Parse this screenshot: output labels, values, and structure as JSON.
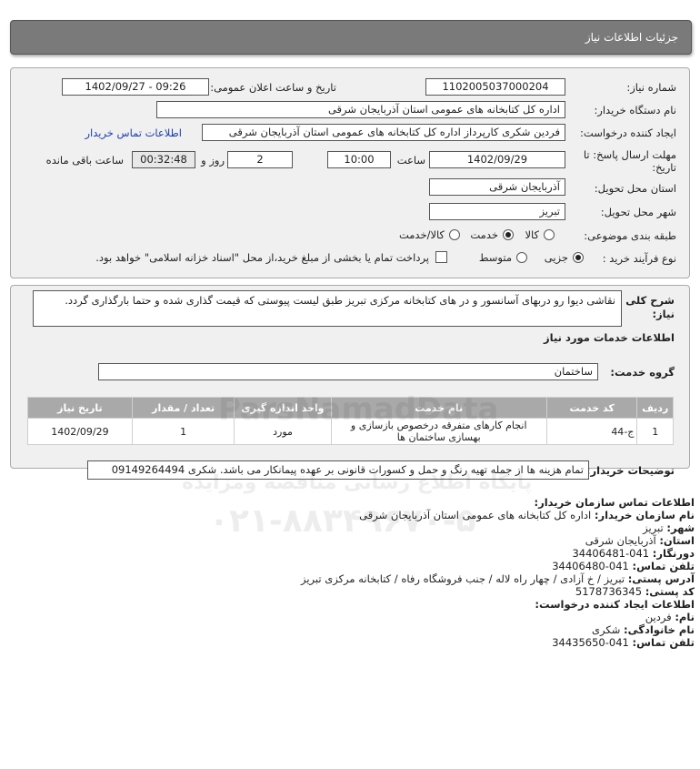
{
  "header": {
    "title": "جزئیات اطلاعات نیاز"
  },
  "need": {
    "need_number_label": "شماره نیاز:",
    "need_number": "1102005037000204",
    "announce_label": "تاریخ و ساعت اعلان عمومی:",
    "announce_value": "1402/09/27 - 09:26",
    "buyer_label": "نام دستگاه خریدار:",
    "buyer_value": "اداره کل کتابخانه های عمومی استان آذربایجان شرقی",
    "creator_label": "ایجاد کننده درخواست:",
    "creator_value": "فردین شکری کارپرداز اداره کل کتابخانه های عمومی استان آذربایجان شرقی",
    "contact_link": "اطلاعات تماس خریدار",
    "deadline_label_1": "مهلت ارسال پاسخ: تا",
    "deadline_label_2": "تاریخ:",
    "deadline_date": "1402/09/29",
    "time_label": "ساعت",
    "deadline_time": "10:00",
    "days_value": "2",
    "days_label": "روز و",
    "remaining_time": "00:32:48",
    "remaining_label": "ساعت باقی مانده",
    "province_label": "استان محل تحویل:",
    "province_value": "آذربایجان شرقی",
    "city_label": "شهر محل تحویل:",
    "city_value": "تبریز",
    "category_label": "طبقه بندی موضوعی:",
    "category_options": [
      "کالا",
      "خدمت",
      "کالا/خدمت"
    ],
    "category_selected": 1,
    "process_label": "نوع فرآیند خرید :",
    "process_options": [
      "جزیی",
      "متوسط"
    ],
    "process_selected": 0,
    "payment_note": "پرداخت تمام یا بخشی از مبلغ خرید،از محل \"اسناد خزانه اسلامی\" خواهد بود."
  },
  "summary": {
    "label_1": "شرح کلی",
    "label_2": "نیاز:",
    "text": "نقاشی دیوا رو دربهای آسانسور و در های کتابخانه مرکزی تبریز طبق لیست پیوستی که قیمت گذاری شده و حتما بارگذاری گردد."
  },
  "services": {
    "title": "اطلاعات خدمات مورد نیاز",
    "group_label": "گروه خدمت:",
    "group_value": "ساختمان",
    "columns": [
      "ردیف",
      "کد خدمت",
      "نام خدمت",
      "واحد اندازه گیری",
      "تعداد / مقدار",
      "تاریخ نیاز"
    ],
    "rows": [
      {
        "index": "1",
        "code": "ج-44",
        "name": "انجام کارهای متفرقه درخصوص بازسازی و بهسازی ساختمان ها",
        "unit": "مورد",
        "qty": "1",
        "date": "1402/09/29"
      }
    ]
  },
  "buyer_notes": {
    "label": "توضیحات خریدار:",
    "text": "تمام هزینه ها از جمله تهیه رنگ و حمل و کسورات قانونی بر عهده پیمانکار می باشد. شکری 09149264494"
  },
  "contact": {
    "title": "اطلاعات تماس سازمان خریدار:",
    "org_label": "نام سازمان خریدار:",
    "org_value": "اداره کل کتابخانه های عمومی استان آذربایجان شرقی",
    "city_label": "شهر:",
    "city_value": "تبریز",
    "province_label": "استان:",
    "province_value": "آذربایجان شرقی",
    "fax_label": "دورنگار:",
    "fax_value": "041-34406481",
    "phone_label": "تلفن تماس:",
    "phone_value": "041-34406480",
    "address_label": "آدرس پستی:",
    "address_value": "تبریز / خ آزادی / چهار راه لاله / جنب فروشگاه رفاه / کتابخانه مرکزی تبریز",
    "postal_label": "کد پستی:",
    "postal_value": "5178736345",
    "creator_title": "اطلاعات ایجاد کننده درخواست:",
    "first_name_label": "نام:",
    "first_name_value": "فردین",
    "last_name_label": "نام خانوادگی:",
    "last_name_value": "شکری",
    "creator_phone_label": "تلفن تماس:",
    "creator_phone_value": "041-34435650"
  },
  "watermark": {
    "brand": "ParsNamadData",
    "line": "پایگاه اطلاع رسانی مناقصه ومزایده",
    "phone": "۰۲۱-۸۸۳۴۹۶۷۰-۵"
  }
}
